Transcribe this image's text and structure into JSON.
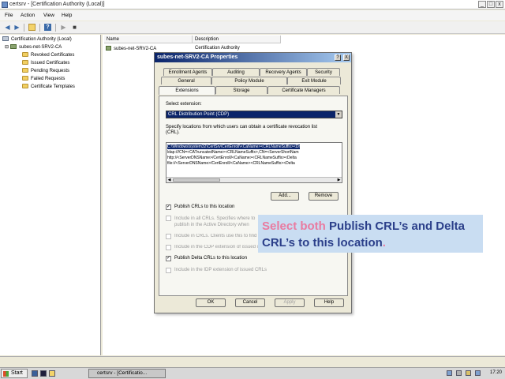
{
  "window": {
    "title": "certsrv - [Certification Authority (Local)]",
    "minimize": "_",
    "maximize": "□",
    "close": "x"
  },
  "menu": {
    "file": "File",
    "action": "Action",
    "view": "View",
    "help": "Help"
  },
  "toolbar": {
    "icons": [
      "back-icon",
      "forward-icon",
      "up-icon",
      "refresh-icon",
      "help-icon",
      "start-service-icon",
      "stop-service-icon"
    ]
  },
  "tree": {
    "root": "Certification Authority (Local)",
    "ca": "subes-net-SRV2-CA",
    "folders": [
      "Revoked Certificates",
      "Issued Certificates",
      "Pending Requests",
      "Failed Requests",
      "Certificate Templates"
    ]
  },
  "list": {
    "columns": [
      "Name",
      "Description"
    ],
    "rows": [
      {
        "name": "subes-net-SRV2-CA",
        "description": "Certification Authority"
      }
    ]
  },
  "dialog": {
    "title": "subes-net-SRV2-CA Properties",
    "help_btn": "?",
    "close_btn": "X",
    "tabs_row1": [
      "Enrollment Agents",
      "Auditing",
      "Recovery Agents",
      "Security"
    ],
    "tabs_row2": [
      "General",
      "Policy Module",
      "Exit Module"
    ],
    "tabs_row3": [
      "Extensions",
      "Storage",
      "Certificate Managers"
    ],
    "select_extension_label": "Select extension:",
    "select_extension_value": "CRL Distribution Point (CDP)",
    "locations_label_1": "Specify locations from which users can obtain a certificate revocation list",
    "locations_label_2": "(CRL).",
    "locations": [
      "C:\\Windows\\system32\\CertSrv\\CertEnroll\\<CaName><CRLNameSuffix><Dr",
      "ldap:///CN=<CATruncatedName><CRLNameSuffix>,CN=<ServerShortNam",
      "http://<ServerDNSName>/CertEnroll/<CaName><CRLNameSuffix><Delta",
      "file://<ServerDNSName>/CertEnroll/<CaName><CRLNameSuffix><Delta"
    ],
    "add_button": "Add...",
    "remove_button": "Remove",
    "options": [
      {
        "label": "Publish CRLs to this location",
        "checked": true,
        "enabled": true
      },
      {
        "label": "Include in all CRLs. Specifies where to publish in the Active Directory when publishing manually.",
        "checked": false,
        "enabled": false
      },
      {
        "label": "Include in CRLs. Clients use this to find Delta CRL locations.",
        "checked": false,
        "enabled": false
      },
      {
        "label": "Include in the CDP extension of issued certificates",
        "checked": false,
        "enabled": false
      },
      {
        "label": "Publish Delta CRLs to this location",
        "checked": true,
        "enabled": true
      },
      {
        "label": "Include in the IDP extension of issued CRLs",
        "checked": false,
        "enabled": false
      }
    ],
    "ok_button": "OK",
    "cancel_button": "Cancel",
    "apply_button": "Apply",
    "help_button": "Help"
  },
  "callout": {
    "part1": "Select both ",
    "part2": "Publish CRL’s and Delta CRL’s to this location",
    "part3": "."
  },
  "taskbar": {
    "start": "Start",
    "task": "certsrv - [Certificatio...",
    "clock": "17:20"
  },
  "colors": {
    "dialog_title": "#0a246a",
    "callout_bg": "#c9ddf2",
    "callout_text": "#2b3f8a",
    "callout_accent": "#e97ba0"
  }
}
